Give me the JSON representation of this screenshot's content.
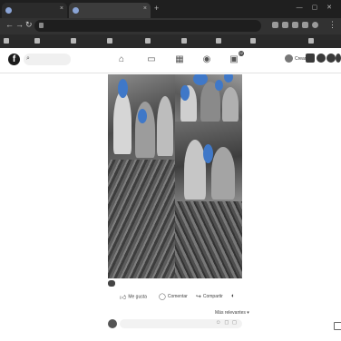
{
  "browser": {
    "tabs": [
      {
        "title": ""
      },
      {
        "title": ""
      }
    ],
    "new_tab_symbol": "+",
    "window_controls": "— ▢ ✕",
    "url": "",
    "bookmarks": [
      {
        "label": ""
      },
      {
        "label": ""
      },
      {
        "label": ""
      },
      {
        "label": ""
      },
      {
        "label": ""
      },
      {
        "label": ""
      },
      {
        "label": ""
      },
      {
        "label": ""
      },
      {
        "label": ""
      }
    ]
  },
  "facebook": {
    "logo_letter": "f",
    "search_placeholder": "",
    "create_label": "Crear",
    "nav_badges": [
      "",
      "",
      "",
      "22"
    ],
    "header_badges": [
      "",
      "",
      ""
    ]
  },
  "post": {
    "reaction_count": "",
    "comments_shares": "",
    "actions": {
      "like": "Me gusta",
      "comment": "Comentar",
      "share": "Compartir"
    },
    "sort_label": "Más relevantes ▾",
    "comment_placeholder": ""
  },
  "colors": {
    "blur_marker": "#3f78c8",
    "chrome_dark": "#1f1f1f"
  }
}
